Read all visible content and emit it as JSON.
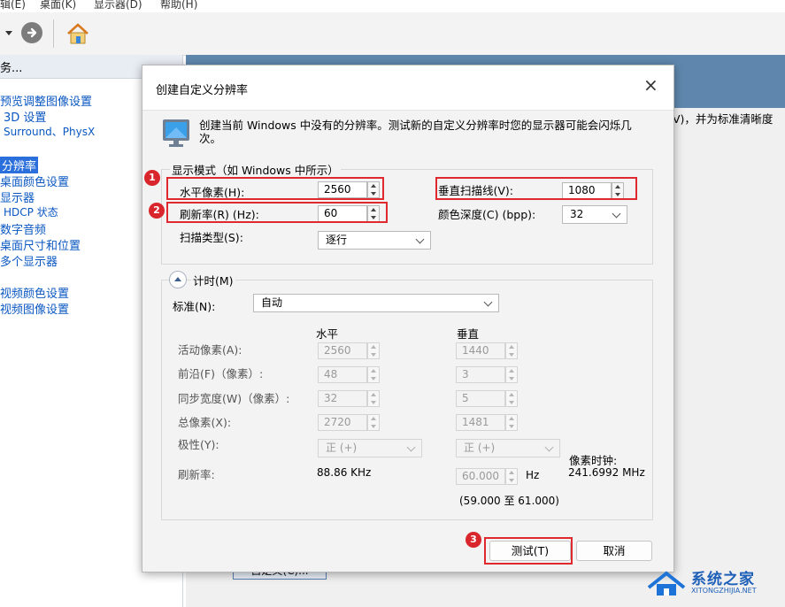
{
  "menubar": {
    "items": [
      "辑(E)",
      "桌面(K)",
      "显示器(D)",
      "帮助(H)"
    ]
  },
  "left_pane": {
    "header": "务...",
    "items": [
      {
        "label": "预览调整图像设置"
      },
      {
        "label": "3D 设置"
      },
      {
        "label": "Surround、PhysX"
      },
      {
        "label": "分辨率"
      },
      {
        "label": "桌面颜色设置"
      },
      {
        "label": "显示器"
      },
      {
        "label": "HDCP 状态"
      },
      {
        "label": "数字音频"
      },
      {
        "label": "桌面尺寸和位置"
      },
      {
        "label": "多个显示器"
      },
      {
        "label": "视频颜色设置"
      },
      {
        "label": "视频图像设置"
      }
    ]
  },
  "background": {
    "right_text": "V)，并为标准清晰度",
    "bottom_button": "自定义(C)..."
  },
  "dialog": {
    "title": "创建自定义分辨率",
    "close_icon": "×",
    "info_text": "创建当前 Windows 中没有的分辨率。测试新的自定义分辨率时您的显示器可能会闪烁几次。",
    "display_mode": {
      "legend": "显示模式（如 Windows 中所示）",
      "h_pixels_label": "水平像素(H):",
      "h_pixels_value": "2560",
      "v_lines_label": "垂直扫描线(V):",
      "v_lines_value": "1080",
      "refresh_label": "刷新率(R) (Hz):",
      "refresh_value": "60",
      "color_depth_label": "颜色深度(C) (bpp):",
      "color_depth_value": "32",
      "scan_type_label": "扫描类型(S):",
      "scan_type_value": "逐行"
    },
    "timing": {
      "toggle_label": "计时(M)",
      "standard_label": "标准(N):",
      "standard_value": "自动",
      "col_horizontal": "水平",
      "col_vertical": "垂直",
      "active_label": "活动像素(A):",
      "active_h": "2560",
      "active_v": "1440",
      "front_label": "前沿(F)（像素）:",
      "front_h": "48",
      "front_v": "3",
      "sync_label": "同步宽度(W)（像素）:",
      "sync_h": "32",
      "sync_v": "5",
      "total_label": "总像素(X):",
      "total_h": "2720",
      "total_v": "1481",
      "polarity_label": "极性(Y):",
      "polarity_h": "正 (+)",
      "polarity_v": "正 (+)",
      "refresh_label": "刷新率:",
      "refresh_h": "88.86 KHz",
      "refresh_v": "60.000",
      "refresh_unit": "Hz",
      "range": "(59.000 至 61.000)",
      "pixel_clock_label": "像素时钟:",
      "pixel_clock_value": "241.6992 MHz"
    },
    "test_button": "测试(T)",
    "cancel_button": "取消"
  },
  "badges": {
    "one": "1",
    "two": "2",
    "three": "3"
  },
  "watermark": {
    "brand": "系统之家",
    "url": "XITONGZHIJIA.NET"
  },
  "colors": {
    "highlight": "#e0282f",
    "selection": "#2a6fdb",
    "link": "#0a57c2",
    "band": "#5f87ad"
  }
}
